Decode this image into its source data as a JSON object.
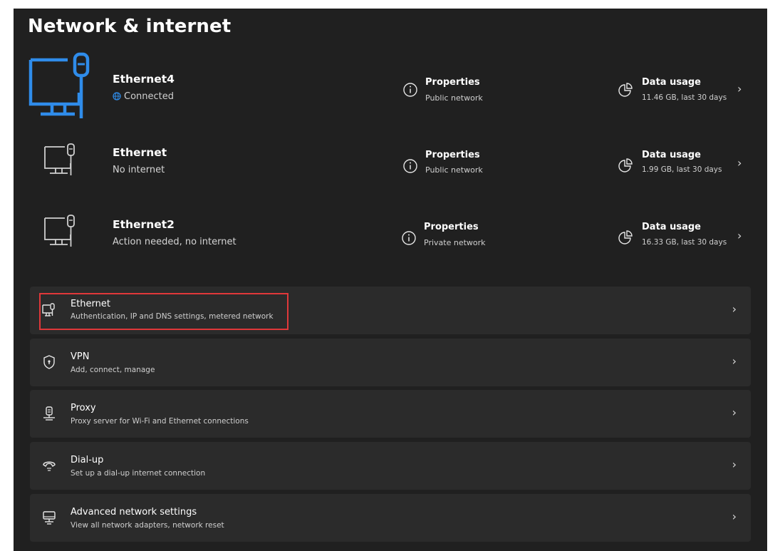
{
  "page": {
    "title": "Network & internet"
  },
  "connections": [
    {
      "name": "Ethernet4",
      "status": "Connected",
      "properties_label": "Properties",
      "network_type": "Public network",
      "usage_label": "Data usage",
      "usage_value": "11.46 GB, last 30 days"
    },
    {
      "name": "Ethernet",
      "status": "No internet",
      "properties_label": "Properties",
      "network_type": "Public network",
      "usage_label": "Data usage",
      "usage_value": "1.99 GB, last 30 days"
    },
    {
      "name": "Ethernet2",
      "status": "Action needed, no internet",
      "properties_label": "Properties",
      "network_type": "Private network",
      "usage_label": "Data usage",
      "usage_value": "16.33 GB, last 30 days"
    }
  ],
  "settings": [
    {
      "title": "Ethernet",
      "subtitle": "Authentication, IP and DNS settings, metered network",
      "icon": "ethernet-icon"
    },
    {
      "title": "VPN",
      "subtitle": "Add, connect, manage",
      "icon": "shield-icon"
    },
    {
      "title": "Proxy",
      "subtitle": "Proxy server for Wi-Fi and Ethernet connections",
      "icon": "proxy-icon"
    },
    {
      "title": "Dial-up",
      "subtitle": "Set up a dial-up internet connection",
      "icon": "dialup-icon"
    },
    {
      "title": "Advanced network settings",
      "subtitle": "View all network adapters, network reset",
      "icon": "advanced-network-icon"
    }
  ],
  "colors": {
    "accent": "#2f8cea",
    "background": "#202020",
    "card": "#2b2b2b",
    "highlight": "#e0383a"
  }
}
